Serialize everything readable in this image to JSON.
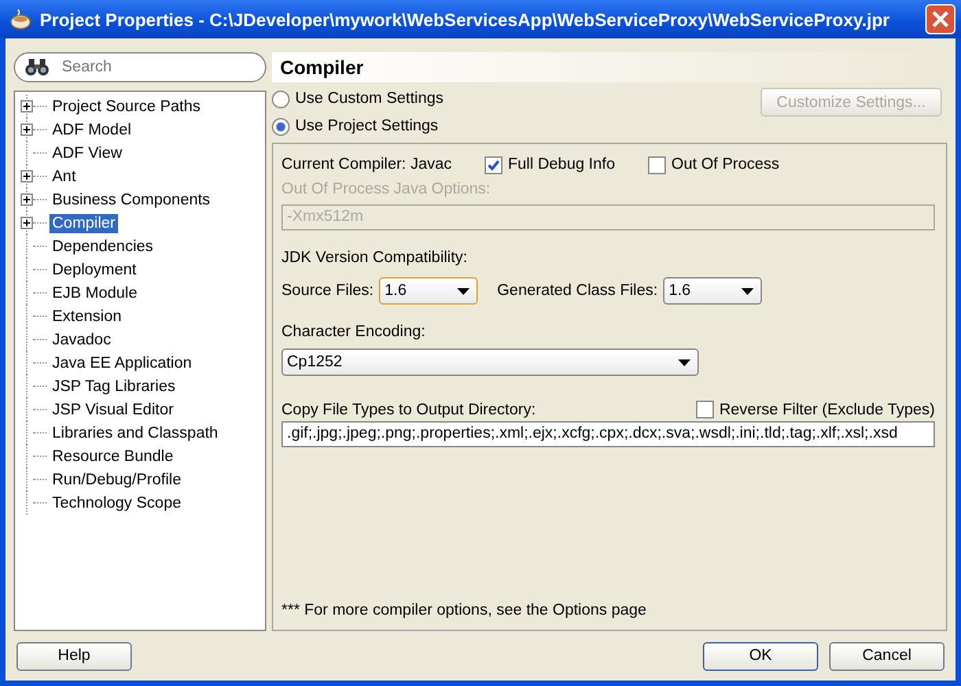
{
  "window": {
    "title": "Project Properties - C:\\JDeveloper\\mywork\\WebServicesApp\\WebServiceProxy\\WebServiceProxy.jpr"
  },
  "search": {
    "placeholder": "Search"
  },
  "tree": [
    {
      "label": "Project Source Paths",
      "expandable": true,
      "selected": false
    },
    {
      "label": "ADF Model",
      "expandable": true,
      "selected": false
    },
    {
      "label": "ADF View",
      "expandable": false,
      "selected": false
    },
    {
      "label": "Ant",
      "expandable": true,
      "selected": false
    },
    {
      "label": "Business Components",
      "expandable": true,
      "selected": false
    },
    {
      "label": "Compiler",
      "expandable": true,
      "selected": true
    },
    {
      "label": "Dependencies",
      "expandable": false,
      "selected": false
    },
    {
      "label": "Deployment",
      "expandable": false,
      "selected": false
    },
    {
      "label": "EJB Module",
      "expandable": false,
      "selected": false
    },
    {
      "label": "Extension",
      "expandable": false,
      "selected": false
    },
    {
      "label": "Javadoc",
      "expandable": false,
      "selected": false
    },
    {
      "label": "Java EE Application",
      "expandable": false,
      "selected": false
    },
    {
      "label": "JSP Tag Libraries",
      "expandable": false,
      "selected": false
    },
    {
      "label": "JSP Visual Editor",
      "expandable": false,
      "selected": false
    },
    {
      "label": "Libraries and Classpath",
      "expandable": false,
      "selected": false
    },
    {
      "label": "Resource Bundle",
      "expandable": false,
      "selected": false
    },
    {
      "label": "Run/Debug/Profile",
      "expandable": false,
      "selected": false
    },
    {
      "label": "Technology Scope",
      "expandable": false,
      "selected": false
    }
  ],
  "page": {
    "heading": "Compiler",
    "radios": [
      {
        "label": "Use Custom Settings",
        "selected": false
      },
      {
        "label": "Use Project Settings",
        "selected": true
      }
    ],
    "customize_button": {
      "label": "Customize Settings...",
      "disabled": true
    },
    "current_compiler": "Current Compiler:  Javac",
    "checkboxes": [
      {
        "label": "Full Debug Info",
        "checked": true
      },
      {
        "label": "Out Of Process",
        "checked": false
      }
    ],
    "java_options": {
      "label": "Out Of Process Java Options:",
      "value": "-Xmx512m",
      "disabled": true
    },
    "jdk_label": "JDK Version Compatibility:",
    "source_files": {
      "label": "Source Files:",
      "value": "1.6"
    },
    "class_files": {
      "label": "Generated Class Files:",
      "value": "1.6"
    },
    "encoding": {
      "label": "Character Encoding:",
      "value": "Cp1252"
    },
    "copy_types": {
      "label": "Copy File Types to Output Directory:",
      "value": ".gif;.jpg;.jpeg;.png;.properties;.xml;.ejx;.xcfg;.cpx;.dcx;.sva;.wsdl;.ini;.tld;.tag;.xlf;.xsl;.xsd"
    },
    "reverse_filter": {
      "label": "Reverse Filter (Exclude Types)",
      "checked": false
    },
    "note": "*** For more compiler options, see the Options page"
  },
  "buttons": {
    "help": "Help",
    "ok": "OK",
    "cancel": "Cancel"
  }
}
